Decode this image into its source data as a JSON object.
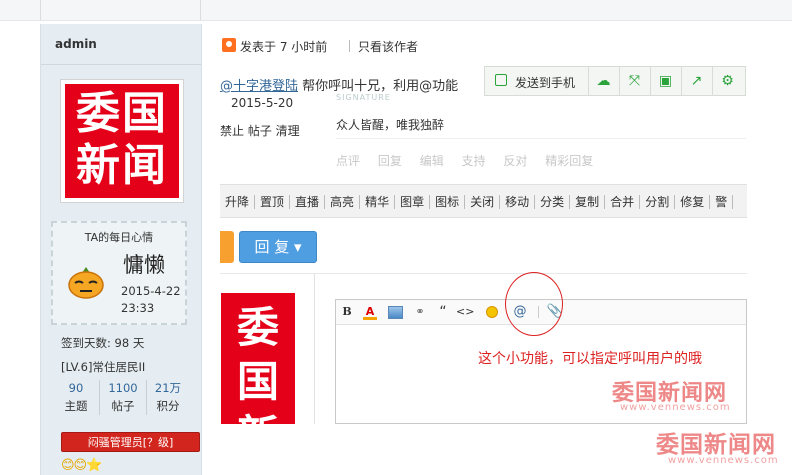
{
  "sidebar": {
    "username": "admin",
    "avatar_logo": "委国新闻",
    "mood": {
      "title": "TA的每日心情",
      "word": "慵懒",
      "date": "2015-4-22",
      "time": "23:33"
    },
    "checkin": "签到天数: 98 天",
    "level": "[LV.6]常住居民II",
    "stats": [
      {
        "value": "90",
        "label": "主题"
      },
      {
        "value": "1100",
        "label": "帖子"
      },
      {
        "value": "21万",
        "label": "积分"
      }
    ],
    "badge": "闷骚管理员[？级]",
    "emotes": "😊😊⭐"
  },
  "post_header": {
    "posted": "发表于 7 小时前",
    "only_author": "只看该作者"
  },
  "screenshot": {
    "mention_prefix": "@十字港登陆",
    "mention_rest": " 帮你呼叫十兄，利用@功能",
    "share_button": "发送到手机",
    "date": "2015-5-20",
    "signature_label": "SIGNATURE",
    "signature_text": "众人皆醒，唯我独醉",
    "controls": "禁止 帖子 清理",
    "faded_actions": [
      "点评",
      "回复",
      "编辑",
      "支持",
      "反对",
      "精彩回复"
    ],
    "admin_actions": [
      "升降",
      "置顶",
      "直播",
      "高亮",
      "精华",
      "图章",
      "图标",
      "关闭",
      "移动",
      "分类",
      "复制",
      "合并",
      "分割",
      "修复",
      "警"
    ],
    "reply_button": "回 复",
    "logo": "委国新闻",
    "annotation": "这个小功能，可以指定呼叫用户的哦",
    "watermark": "委国新闻网",
    "watermark_url": "www.vennews.com"
  },
  "watermark": {
    "text": "委国新闻网",
    "url": "www.vennews.com"
  },
  "colors": {
    "accent": "#4f9ee2",
    "logo_red": "#e5001a",
    "annotation_red": "#dd2222",
    "sidebar_bg": "#e5edf2"
  }
}
